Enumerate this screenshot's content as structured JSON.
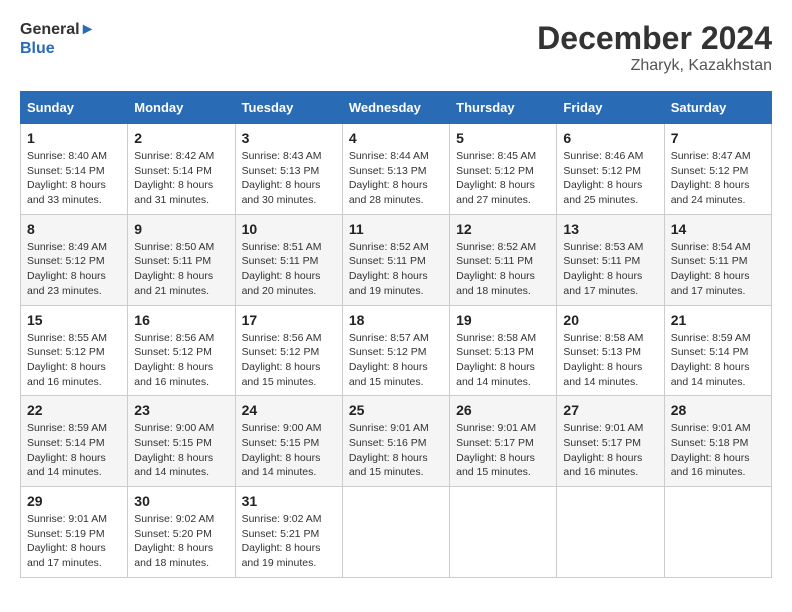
{
  "header": {
    "logo_line1": "General",
    "logo_line2": "Blue",
    "month": "December 2024",
    "location": "Zharyk, Kazakhstan"
  },
  "weekdays": [
    "Sunday",
    "Monday",
    "Tuesday",
    "Wednesday",
    "Thursday",
    "Friday",
    "Saturday"
  ],
  "weeks": [
    [
      {
        "day": "1",
        "sunrise": "8:40 AM",
        "sunset": "5:14 PM",
        "daylight": "8 hours and 33 minutes."
      },
      {
        "day": "2",
        "sunrise": "8:42 AM",
        "sunset": "5:14 PM",
        "daylight": "8 hours and 31 minutes."
      },
      {
        "day": "3",
        "sunrise": "8:43 AM",
        "sunset": "5:13 PM",
        "daylight": "8 hours and 30 minutes."
      },
      {
        "day": "4",
        "sunrise": "8:44 AM",
        "sunset": "5:13 PM",
        "daylight": "8 hours and 28 minutes."
      },
      {
        "day": "5",
        "sunrise": "8:45 AM",
        "sunset": "5:12 PM",
        "daylight": "8 hours and 27 minutes."
      },
      {
        "day": "6",
        "sunrise": "8:46 AM",
        "sunset": "5:12 PM",
        "daylight": "8 hours and 25 minutes."
      },
      {
        "day": "7",
        "sunrise": "8:47 AM",
        "sunset": "5:12 PM",
        "daylight": "8 hours and 24 minutes."
      }
    ],
    [
      {
        "day": "8",
        "sunrise": "8:49 AM",
        "sunset": "5:12 PM",
        "daylight": "8 hours and 23 minutes."
      },
      {
        "day": "9",
        "sunrise": "8:50 AM",
        "sunset": "5:11 PM",
        "daylight": "8 hours and 21 minutes."
      },
      {
        "day": "10",
        "sunrise": "8:51 AM",
        "sunset": "5:11 PM",
        "daylight": "8 hours and 20 minutes."
      },
      {
        "day": "11",
        "sunrise": "8:52 AM",
        "sunset": "5:11 PM",
        "daylight": "8 hours and 19 minutes."
      },
      {
        "day": "12",
        "sunrise": "8:52 AM",
        "sunset": "5:11 PM",
        "daylight": "8 hours and 18 minutes."
      },
      {
        "day": "13",
        "sunrise": "8:53 AM",
        "sunset": "5:11 PM",
        "daylight": "8 hours and 17 minutes."
      },
      {
        "day": "14",
        "sunrise": "8:54 AM",
        "sunset": "5:11 PM",
        "daylight": "8 hours and 17 minutes."
      }
    ],
    [
      {
        "day": "15",
        "sunrise": "8:55 AM",
        "sunset": "5:12 PM",
        "daylight": "8 hours and 16 minutes."
      },
      {
        "day": "16",
        "sunrise": "8:56 AM",
        "sunset": "5:12 PM",
        "daylight": "8 hours and 16 minutes."
      },
      {
        "day": "17",
        "sunrise": "8:56 AM",
        "sunset": "5:12 PM",
        "daylight": "8 hours and 15 minutes."
      },
      {
        "day": "18",
        "sunrise": "8:57 AM",
        "sunset": "5:12 PM",
        "daylight": "8 hours and 15 minutes."
      },
      {
        "day": "19",
        "sunrise": "8:58 AM",
        "sunset": "5:13 PM",
        "daylight": "8 hours and 14 minutes."
      },
      {
        "day": "20",
        "sunrise": "8:58 AM",
        "sunset": "5:13 PM",
        "daylight": "8 hours and 14 minutes."
      },
      {
        "day": "21",
        "sunrise": "8:59 AM",
        "sunset": "5:14 PM",
        "daylight": "8 hours and 14 minutes."
      }
    ],
    [
      {
        "day": "22",
        "sunrise": "8:59 AM",
        "sunset": "5:14 PM",
        "daylight": "8 hours and 14 minutes."
      },
      {
        "day": "23",
        "sunrise": "9:00 AM",
        "sunset": "5:15 PM",
        "daylight": "8 hours and 14 minutes."
      },
      {
        "day": "24",
        "sunrise": "9:00 AM",
        "sunset": "5:15 PM",
        "daylight": "8 hours and 14 minutes."
      },
      {
        "day": "25",
        "sunrise": "9:01 AM",
        "sunset": "5:16 PM",
        "daylight": "8 hours and 15 minutes."
      },
      {
        "day": "26",
        "sunrise": "9:01 AM",
        "sunset": "5:17 PM",
        "daylight": "8 hours and 15 minutes."
      },
      {
        "day": "27",
        "sunrise": "9:01 AM",
        "sunset": "5:17 PM",
        "daylight": "8 hours and 16 minutes."
      },
      {
        "day": "28",
        "sunrise": "9:01 AM",
        "sunset": "5:18 PM",
        "daylight": "8 hours and 16 minutes."
      }
    ],
    [
      {
        "day": "29",
        "sunrise": "9:01 AM",
        "sunset": "5:19 PM",
        "daylight": "8 hours and 17 minutes."
      },
      {
        "day": "30",
        "sunrise": "9:02 AM",
        "sunset": "5:20 PM",
        "daylight": "8 hours and 18 minutes."
      },
      {
        "day": "31",
        "sunrise": "9:02 AM",
        "sunset": "5:21 PM",
        "daylight": "8 hours and 19 minutes."
      },
      null,
      null,
      null,
      null
    ]
  ]
}
